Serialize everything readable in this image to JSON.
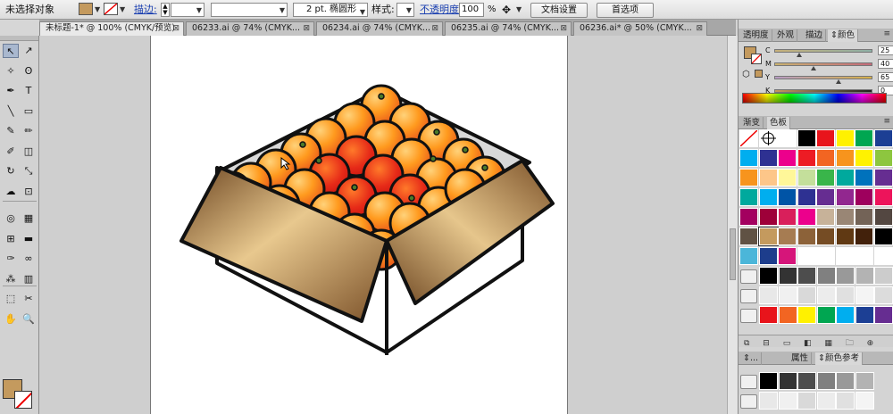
{
  "control_bar": {
    "selection_label": "未选择对象",
    "fill_color": "#c49a5e",
    "stroke_label": "描边:",
    "stroke_size": "2 pt. 椭圆形",
    "style_label": "样式:",
    "opacity_label": "不透明度:",
    "opacity_value": "100",
    "opacity_unit": "%",
    "doc_setup": "文档设置",
    "prefs": "首选项"
  },
  "tabs": [
    {
      "label": "未标题-1* @ 100% (CMYK/预览)",
      "close": "⊠",
      "active": true
    },
    {
      "label": "06233.ai @ 74% (CMYK...",
      "close": "⊠",
      "active": false
    },
    {
      "label": "06234.ai @ 74% (CMYK...",
      "close": "⊠",
      "active": false
    },
    {
      "label": "06235.ai @ 74% (CMYK...",
      "close": "⊠",
      "active": false
    },
    {
      "label": "06236.ai* @ 50% (CMYK...",
      "close": "⊠",
      "active": false
    }
  ],
  "tools": [
    {
      "name": "selection-tool",
      "glyph": "↖",
      "selected": true
    },
    {
      "name": "direct-selection-tool",
      "glyph": "↗"
    },
    {
      "name": "magic-wand-tool",
      "glyph": "✧"
    },
    {
      "name": "lasso-tool",
      "glyph": "ʘ"
    },
    {
      "name": "pen-tool",
      "glyph": "✒"
    },
    {
      "name": "type-tool",
      "glyph": "T"
    },
    {
      "name": "line-tool",
      "glyph": "╲"
    },
    {
      "name": "rectangle-tool",
      "glyph": "▭"
    },
    {
      "name": "paintbrush-tool",
      "glyph": "✎"
    },
    {
      "name": "pencil-tool",
      "glyph": "✏"
    },
    {
      "name": "blob-brush-tool",
      "glyph": "✐"
    },
    {
      "name": "eraser-tool",
      "glyph": "◫"
    },
    {
      "name": "rotate-tool",
      "glyph": "↻"
    },
    {
      "name": "scale-tool",
      "glyph": "⤡"
    },
    {
      "name": "warp-tool",
      "glyph": "☁"
    },
    {
      "name": "free-transform-tool",
      "glyph": "⊡"
    },
    {
      "name": "shape-builder-tool",
      "glyph": "◎"
    },
    {
      "name": "perspective-grid-tool",
      "glyph": "▦"
    },
    {
      "name": "mesh-tool",
      "glyph": "⊞"
    },
    {
      "name": "gradient-tool",
      "glyph": "▬"
    },
    {
      "name": "eyedropper-tool",
      "glyph": "✑"
    },
    {
      "name": "blend-tool",
      "glyph": "∞"
    },
    {
      "name": "symbol-sprayer-tool",
      "glyph": "⁂"
    },
    {
      "name": "column-graph-tool",
      "glyph": "▥"
    },
    {
      "name": "artboard-tool",
      "glyph": "⬚"
    },
    {
      "name": "slice-tool",
      "glyph": "✂"
    },
    {
      "name": "hand-tool",
      "glyph": "✋"
    },
    {
      "name": "zoom-tool",
      "glyph": "🔍"
    }
  ],
  "tool_extras": {
    "color_mode_1": "↰",
    "color_mode_2": "↱",
    "swap": "↯",
    "none": "⊘",
    "screen": "⊕"
  },
  "color_panel": {
    "tabs": [
      "透明度",
      "外观",
      "描边",
      "⇕颜色"
    ],
    "channels": [
      {
        "label": "C",
        "value": "25",
        "pos": 0.25,
        "grad": [
          "#c7b07a",
          "#8eb0a6"
        ]
      },
      {
        "label": "M",
        "value": "40",
        "pos": 0.4,
        "grad": [
          "#c9b270",
          "#c46a7a"
        ]
      },
      {
        "label": "Y",
        "value": "65",
        "pos": 0.65,
        "grad": [
          "#b89cc4",
          "#d5b04a"
        ]
      },
      {
        "label": "K",
        "value": "0",
        "pos": 0.0,
        "grad": [
          "#c49a5e",
          "#202020"
        ]
      }
    ],
    "pct": "%"
  },
  "swatches_panel": {
    "tabs": [
      "渐变",
      "色板"
    ],
    "rows": [
      [
        "#ffffff",
        "#ffffff",
        "#ffffff",
        "#000000",
        "#e8141b",
        "#fff100",
        "#00a651",
        "#1c3f94"
      ],
      [
        "#00aeef",
        "#2e3192",
        "#ec008c",
        "#ed1c24",
        "#f26522",
        "#f7941d",
        "#fff200",
        "#8dc63f"
      ],
      [
        "#f7941d",
        "#fdc689",
        "#fff799",
        "#c4df9b",
        "#39b54a",
        "#00a99d",
        "#0072bc",
        "#662d91"
      ],
      [
        "#00a99d",
        "#00aeef",
        "#0054a6",
        "#2e3192",
        "#662d91",
        "#92278f",
        "#9e005d",
        "#ed145b"
      ],
      [
        "#a3005f",
        "#9e0039",
        "#d91f5b",
        "#ec008c",
        "#c7b299",
        "#998675",
        "#736357",
        "#534741"
      ],
      [
        "#605244",
        "#c49a5e",
        "#a67c52",
        "#8c6239",
        "#754c24",
        "#603913",
        "#42210b",
        "#000000"
      ],
      [
        "#4bb6d9",
        "#1d3d8c",
        "#d6157a",
        "#ffffff",
        "#ffffff",
        "#ffffff",
        "#ffffff",
        "#ffffff"
      ]
    ],
    "group1": [
      "#000000",
      "#333333",
      "#4d4d4d",
      "#808080",
      "#999999",
      "#b3b3b3",
      "#cccccc"
    ],
    "group2": [
      "#e8e8e8",
      "#f0f0f0",
      "#d9d9d9",
      "#ececec",
      "#e0e0e0",
      "#f4f4f4",
      "#dcdcdc"
    ],
    "group3": [
      "#e8141b",
      "#f26522",
      "#fff100",
      "#00a651",
      "#00aeef",
      "#1c3f94",
      "#662d91"
    ]
  },
  "bottom_panel": {
    "tabs": [
      "⇕...",
      "属性",
      "⇕颜色参考"
    ],
    "group1": [
      "#000000",
      "#333333",
      "#4d4d4d",
      "#808080",
      "#999999",
      "#b3b3b3"
    ],
    "group2": [
      "#e8e8e8",
      "#f0f0f0",
      "#d9d9d9",
      "#ececec",
      "#e0e0e0",
      "#f4f4f4"
    ]
  },
  "panel_footer_icons": "⧉ ⊟ ▭ ◧ ▦ 🗀 ⊕ 🗑"
}
